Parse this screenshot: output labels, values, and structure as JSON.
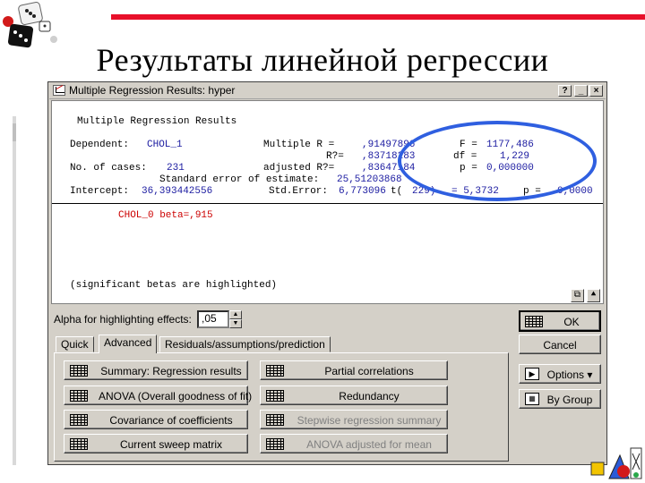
{
  "slide": {
    "title": "Результаты линейной регрессии"
  },
  "window": {
    "title": "Multiple Regression Results: hyper",
    "help_btn": "?",
    "min_btn": "_",
    "max_btn": "□",
    "close_btn": "×"
  },
  "output": {
    "header": "Multiple Regression Results",
    "dependent_label": "Dependent:",
    "dependent_value": "CHOL_1",
    "multiple_r_label": "Multiple R =",
    "multiple_r_value": ",91497896",
    "f_label": "F =",
    "f_value": "1177,486",
    "r2_label": "R?=",
    "r2_value": ",83718283",
    "df_label": "df =",
    "df_value": "1,229",
    "cases_label": "No. of cases:",
    "cases_value": "231",
    "adj_r2_label": "adjusted R?=",
    "adj_r2_value": ",83647184",
    "p_label": "p =",
    "p_value": "0,000000",
    "std_err_est_label": "Standard error of estimate:",
    "std_err_est_value": "25,51203868",
    "intercept_label": "Intercept:",
    "intercept_value": "36,393442556",
    "std_error_label": "Std.Error:",
    "std_error_value": "6,773096",
    "t_label": "t(",
    "t_df": "229)",
    "t_value": "= 5,3732",
    "p2_label": "p =",
    "p2_value": "0,0000",
    "beta_line": "CHOL_0 beta=,915",
    "footnote": "(significant betas are highlighted)"
  },
  "controls": {
    "alpha_label": "Alpha for highlighting effects:",
    "alpha_value": ",05",
    "tabs": [
      "Quick",
      "Advanced",
      "Residuals/assumptions/prediction"
    ],
    "active_tab": "Advanced",
    "buttons_left": [
      {
        "label": "Summary:  Regression results",
        "enabled": true
      },
      {
        "label": "ANOVA (Overall goodness of fit)",
        "enabled": true
      },
      {
        "label": "Covariance of coefficients",
        "enabled": true
      },
      {
        "label": "Current sweep matrix",
        "enabled": true
      }
    ],
    "buttons_right": [
      {
        "label": "Partial correlations",
        "enabled": true
      },
      {
        "label": "Redundancy",
        "enabled": true
      },
      {
        "label": "Stepwise regression summary",
        "enabled": false
      },
      {
        "label": "ANOVA adjusted for mean",
        "enabled": false
      }
    ],
    "ok": "OK",
    "cancel": "Cancel",
    "options": "Options ▾",
    "by_group": "By Group"
  },
  "colors": {
    "accent_red": "#e8102a",
    "highlight_circle": "#2f5fe0",
    "window_face": "#d4d0c8"
  }
}
